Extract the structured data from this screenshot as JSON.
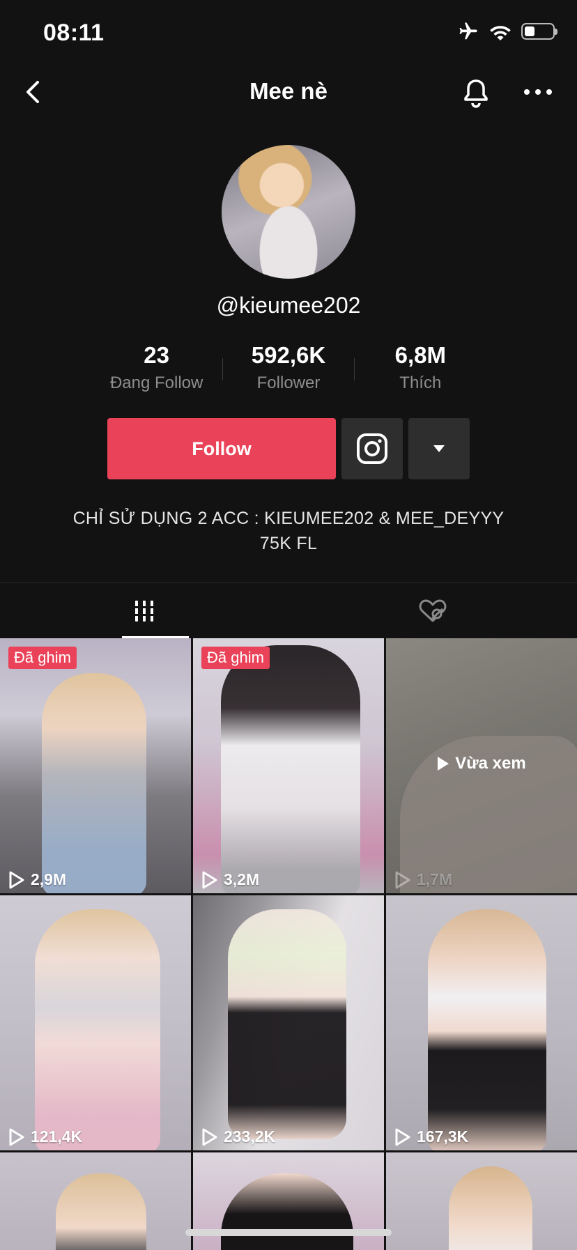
{
  "status_bar": {
    "time": "08:11",
    "icons": [
      "airplane-icon",
      "wifi-icon",
      "battery-icon"
    ]
  },
  "nav": {
    "title": "Mee nè",
    "back_icon": "chevron-left-icon",
    "bell_icon": "bell-icon",
    "more_icon": "more-icon"
  },
  "profile": {
    "handle": "@kieumee202",
    "stats": [
      {
        "value": "23",
        "label": "Đang Follow"
      },
      {
        "value": "592,6K",
        "label": "Follower"
      },
      {
        "value": "6,8M",
        "label": "Thích"
      }
    ],
    "follow_label": "Follow",
    "bio_line1": "CHỈ SỬ DỤNG 2 ACC : KIEUMEE202 & MEE_DEYYY",
    "bio_line2": "75K FL"
  },
  "tabs": [
    {
      "name": "videos",
      "icon": "grid-icon",
      "active": true
    },
    {
      "name": "liked",
      "icon": "hidden-heart-icon",
      "active": false
    }
  ],
  "videos": [
    {
      "pinned": "Đã ghim",
      "views": "2,9M"
    },
    {
      "pinned": "Đã ghim",
      "views": "3,2M"
    },
    {
      "watched": "Vừa xem",
      "views": "1,7M"
    },
    {
      "views": "121,4K"
    },
    {
      "views": "233,2K"
    },
    {
      "views": "167,3K"
    }
  ],
  "colors": {
    "accent": "#ea4359",
    "background": "#121212",
    "button_dark": "#2e2e2e"
  }
}
